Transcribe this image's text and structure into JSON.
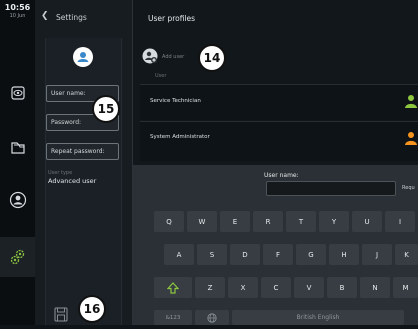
{
  "status": {
    "time": "10:56",
    "date": "10 Jun"
  },
  "settings": {
    "title": "Settings",
    "fields": {
      "username_placeholder": "User name:",
      "password_placeholder": "Password:",
      "repeat_password_placeholder": "Repeat password:"
    },
    "user_type_label": "User type",
    "user_type_value": "Advanced user"
  },
  "main": {
    "title": "User profiles",
    "add_user_label": "Add user",
    "column_user": "User",
    "users": [
      {
        "label": "Service Technician",
        "color": "#8dc63f"
      },
      {
        "label": "System Administrator",
        "color": "#f7941d"
      }
    ]
  },
  "keyboard": {
    "username_label": "User name:",
    "required_label": "Requ",
    "rows": [
      [
        "Q",
        "W",
        "E",
        "R",
        "T",
        "Y",
        "U",
        "I"
      ],
      [
        "A",
        "S",
        "D",
        "F",
        "G",
        "H",
        "J",
        "K"
      ],
      [
        "Z",
        "X",
        "C",
        "V",
        "B",
        "N",
        "M"
      ]
    ],
    "num_key": "&123",
    "language_key": "British English"
  },
  "callouts": [
    "14",
    "15",
    "16"
  ],
  "colors": {
    "accent_green": "#8dc63f",
    "accent_orange": "#f7941d",
    "avatar_blue": "#3a87c9"
  }
}
